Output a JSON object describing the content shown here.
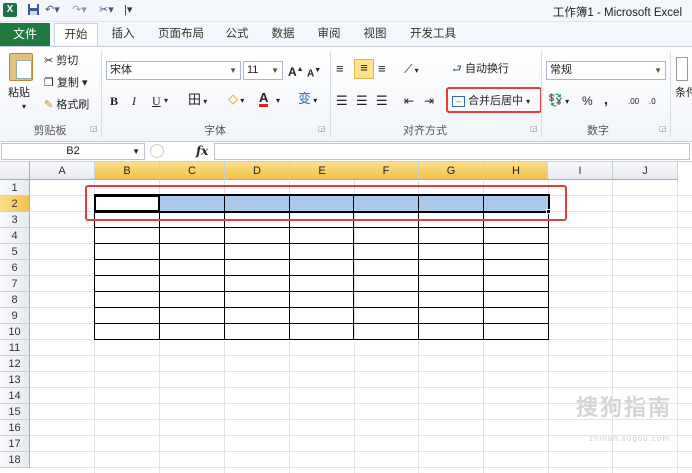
{
  "window": {
    "title": "工作簿1 - Microsoft Excel",
    "logo": "X"
  },
  "quick_access": {
    "save_icon": "save-icon",
    "undo_icon": "undo-icon",
    "redo_icon": "redo-icon",
    "customize_icon": "customize-icon"
  },
  "tabs": [
    {
      "label": "文件"
    },
    {
      "label": "开始"
    },
    {
      "label": "插入"
    },
    {
      "label": "页面布局"
    },
    {
      "label": "公式"
    },
    {
      "label": "数据"
    },
    {
      "label": "审阅"
    },
    {
      "label": "视图"
    },
    {
      "label": "开发工具"
    }
  ],
  "ribbon": {
    "clipboard": {
      "paste": "粘贴",
      "cut": "剪切",
      "copy": "复制",
      "format_painter": "格式刷",
      "group": "剪贴板"
    },
    "font": {
      "name": "宋体",
      "size": "11",
      "bold": "B",
      "italic": "I",
      "underline": "U",
      "grow": "A",
      "shrink": "A",
      "border": "田",
      "fill": "◇",
      "font_color": "A",
      "phonetic": "变",
      "group": "字体"
    },
    "alignment": {
      "wrap": "自动换行",
      "merge": "合并后居中",
      "group": "对齐方式"
    },
    "number": {
      "format": "常规",
      "percent": "%",
      "comma": ",",
      "inc_decimal": ".00",
      "dec_decimal": ".0",
      "group": "数字"
    },
    "styles": {
      "cond_partial": "条件"
    }
  },
  "formula_bar": {
    "name_box": "B2",
    "fx": "fx",
    "value": ""
  },
  "columns": [
    "A",
    "B",
    "C",
    "D",
    "E",
    "F",
    "G",
    "H",
    "I",
    "J"
  ],
  "rows": [
    "1",
    "2",
    "3",
    "4",
    "5",
    "6",
    "7",
    "8",
    "9",
    "10",
    "11",
    "12",
    "13",
    "14",
    "15",
    "16",
    "17",
    "18"
  ],
  "selection": {
    "range": "B2:H2",
    "active": "B2"
  },
  "colors": {
    "excel_green": "#1f7a3f",
    "selection": "#a9c8ea",
    "header_selected": "#f1c04a",
    "callout": "#e0403a"
  },
  "watermark": {
    "text": "搜狗指南",
    "sub": "zhinan.sogou.com"
  }
}
